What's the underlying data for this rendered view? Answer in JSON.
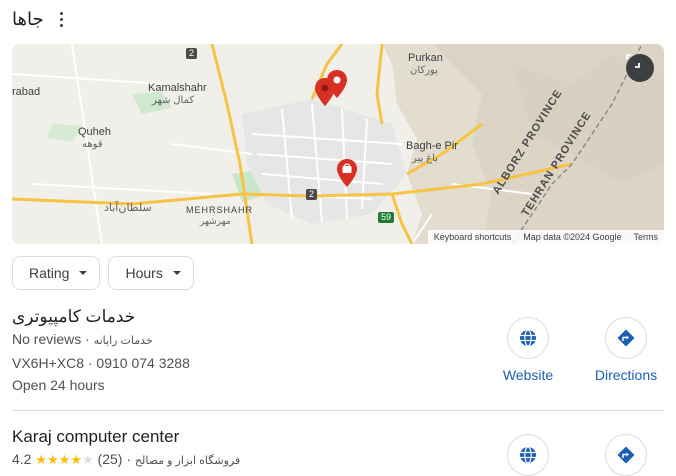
{
  "header": {
    "title": "جاها"
  },
  "map": {
    "labels": {
      "kamalshahr_en": "Kamalshahr",
      "kamalshahr_fa": "کمال شهر",
      "rabad": "rabad",
      "quheh_en": "Quheh",
      "quheh_fa": "قوهه",
      "purkan_en": "Purkan",
      "purkan_fa": "پورکان",
      "baghepir_en": "Bagh-e Pir",
      "baghepir_fa": "باغ پیر",
      "soltanabad_fa": "سلطان‌آباد",
      "mehrshahr_en": "MEHRSHAHR",
      "mehrshahr_fa": "مهرشهر",
      "alborz": "ALBORZ PROVINCE",
      "tehran": "TEHRAN PROVINCE"
    },
    "road_badges": {
      "r2a": "2",
      "r2b": "2",
      "r59": "59"
    },
    "footer": {
      "shortcuts": "Keyboard shortcuts",
      "data": "Map data ©2024 Google",
      "terms": "Terms"
    }
  },
  "filters": [
    {
      "label": "Rating"
    },
    {
      "label": "Hours"
    }
  ],
  "listings": [
    {
      "name": "خدمات کامپیوتری",
      "reviews": "No reviews",
      "category": "خدمات رایانه",
      "address": "VX6H+XC8 · 0910 074 3288",
      "hours": "Open 24 hours",
      "website_label": "Website",
      "directions_label": "Directions"
    },
    {
      "name": "Karaj computer center",
      "rating": "4.2",
      "review_count": "(25)",
      "category": "فروشگاه ابزار و مصالح"
    }
  ],
  "colors": {
    "link_blue": "#1a5fb4",
    "star": "#fbbc04",
    "pin_red": "#d93025"
  }
}
